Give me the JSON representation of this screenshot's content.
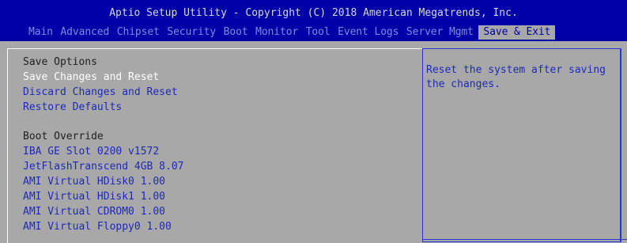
{
  "title": "Aptio Setup Utility - Copyright (C) 2018 American Megatrends, Inc.",
  "tabs": [
    {
      "label": "Main"
    },
    {
      "label": "Advanced"
    },
    {
      "label": "Chipset"
    },
    {
      "label": "Security"
    },
    {
      "label": "Boot"
    },
    {
      "label": "Monitor"
    },
    {
      "label": "Tool"
    },
    {
      "label": "Event Logs"
    },
    {
      "label": "Server Mgmt"
    },
    {
      "label": "Save & Exit",
      "active": true
    }
  ],
  "save_options": {
    "heading": "Save Options",
    "items": [
      {
        "label": "Save Changes and Reset",
        "selected": true
      },
      {
        "label": "Discard Changes and Reset"
      },
      {
        "label": "Restore Defaults"
      }
    ]
  },
  "boot_override": {
    "heading": "Boot Override",
    "items": [
      {
        "label": "IBA GE Slot 0200 v1572"
      },
      {
        "label": "JetFlashTranscend 4GB 8.07"
      },
      {
        "label": "AMI Virtual HDisk0 1.00"
      },
      {
        "label": "AMI Virtual HDisk1 1.00"
      },
      {
        "label": "AMI Virtual CDROM0 1.00"
      },
      {
        "label": "AMI Virtual Floppy0 1.00"
      }
    ]
  },
  "help": {
    "text": "Reset the system after saving the changes."
  },
  "colors": {
    "background": "#0000a8",
    "panel": "#a8a8a8",
    "item_text": "#1d2ab8",
    "selected_text": "#ffffff",
    "heading_text": "#202020"
  }
}
